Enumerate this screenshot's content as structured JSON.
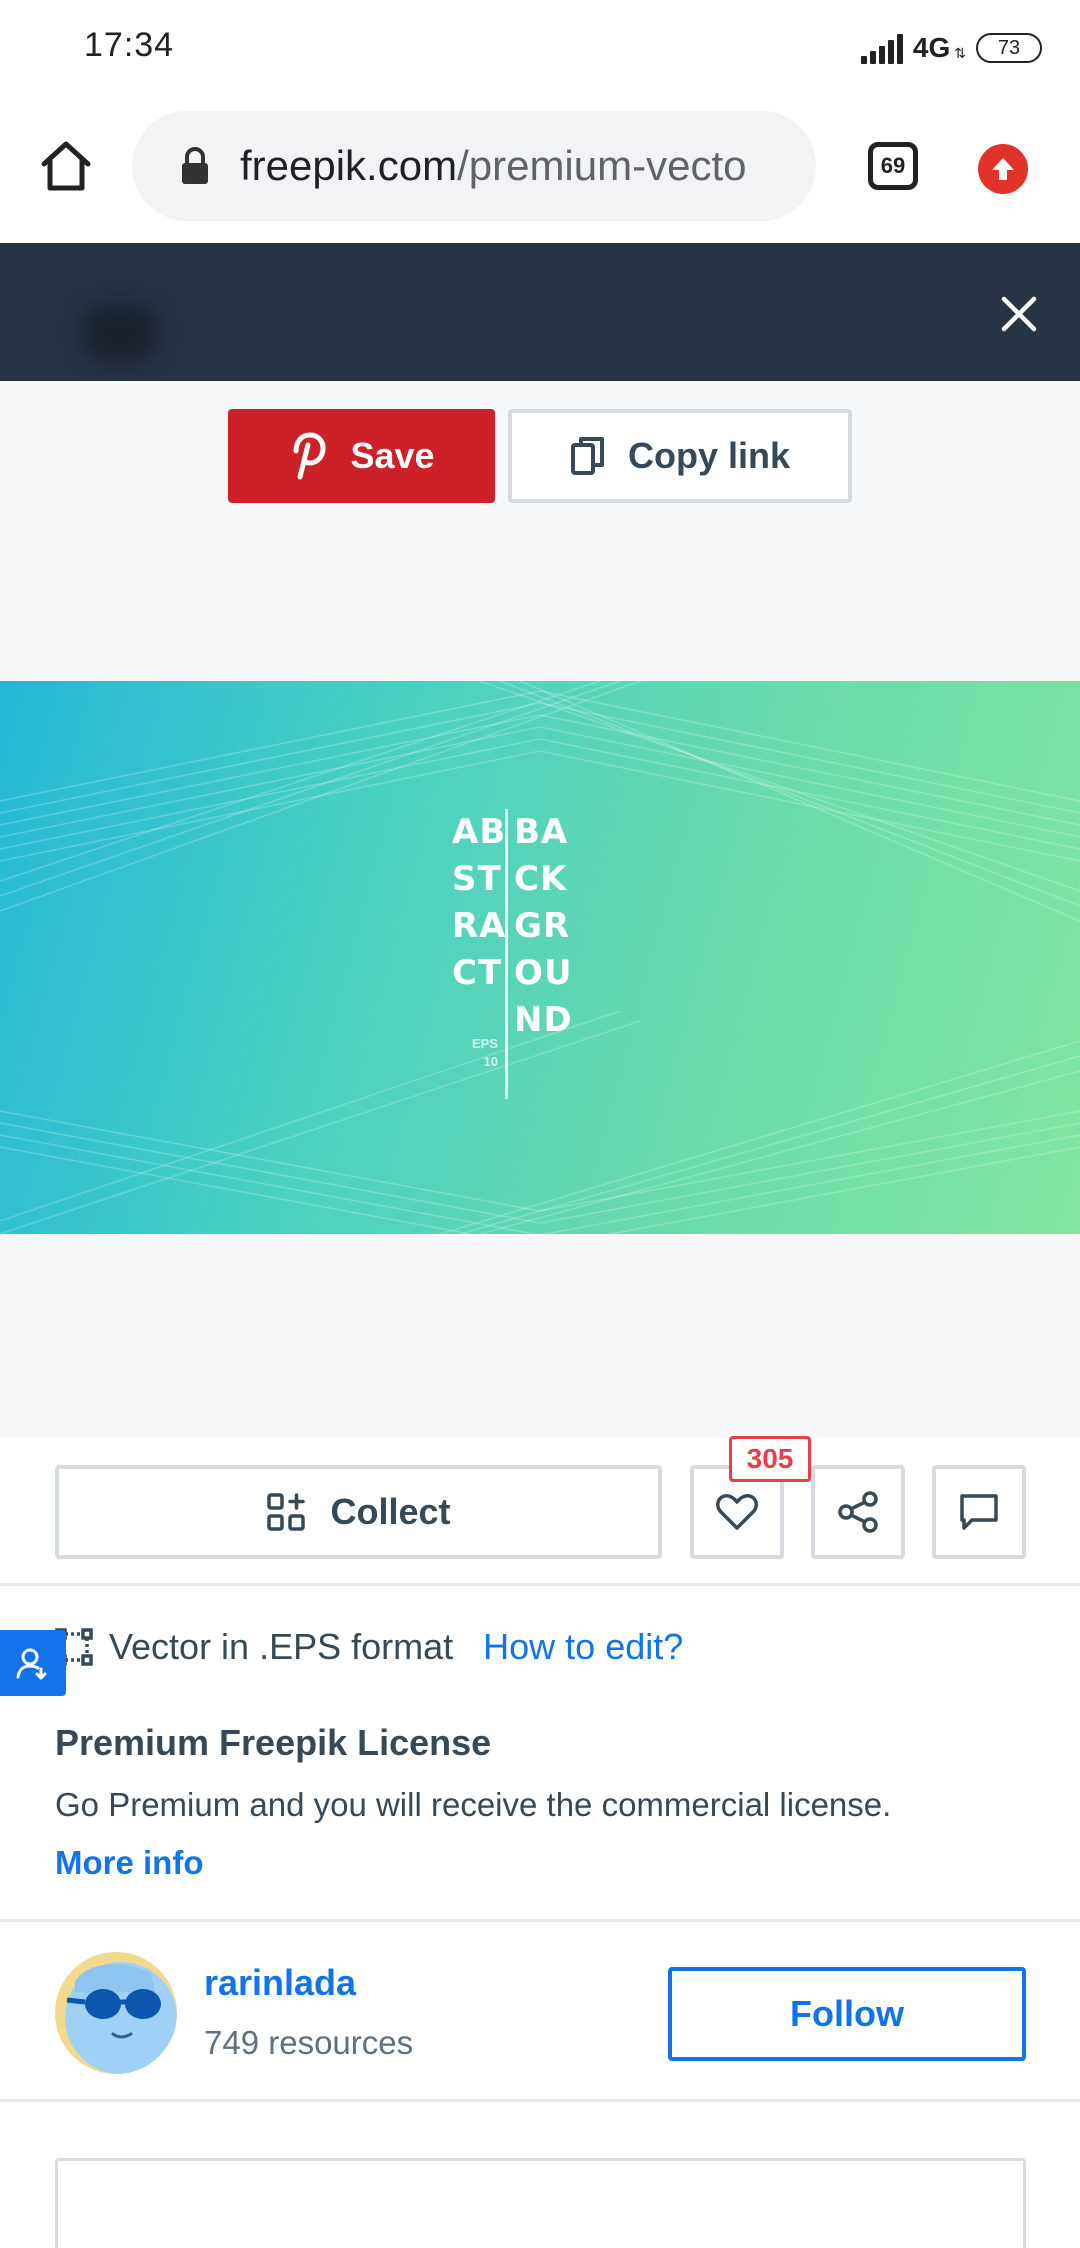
{
  "status_bar": {
    "time": "17:34",
    "network": "4G",
    "battery": "73"
  },
  "browser": {
    "url_domain": "freepik.com",
    "url_path": "/premium-vecto",
    "tab_count": "69"
  },
  "share": {
    "save_label": "Save",
    "copy_label": "Copy link",
    "save_color": "#cd2129"
  },
  "preview": {
    "art_left": [
      "AB",
      "ST",
      "RA",
      "CT"
    ],
    "art_right": [
      "BA",
      "CK",
      "GR",
      "OU",
      "ND"
    ],
    "art_eps": [
      "EPS",
      "10"
    ]
  },
  "actions": {
    "collect_label": "Collect",
    "like_count": "305"
  },
  "info": {
    "format_text": "Vector in .EPS format",
    "how_to_edit": "How to edit?",
    "license_title": "Premium Freepik License",
    "license_desc": "Go Premium and you will receive the commercial license.",
    "more_info": "More info"
  },
  "author": {
    "name": "rarinlada",
    "resources": "749 resources",
    "follow_label": "Follow"
  },
  "colors": {
    "accent_blue": "#1273eb",
    "like_red": "#e8404a",
    "banner_dark": "#263444"
  }
}
